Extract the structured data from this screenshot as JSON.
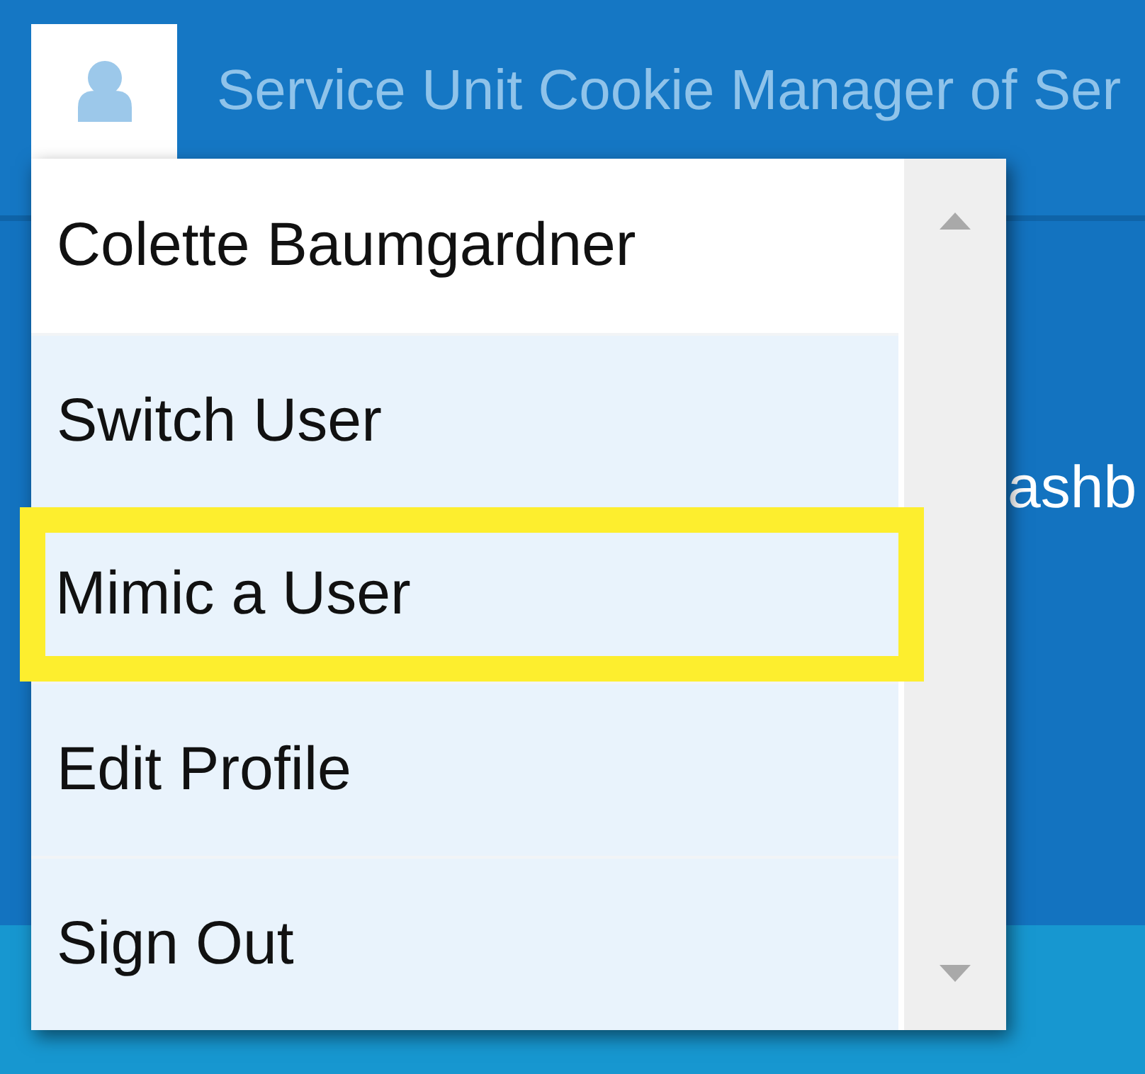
{
  "header": {
    "title": "Service Unit Cookie Manager of Ser"
  },
  "page": {
    "heading": "ashb"
  },
  "user_menu": {
    "items": [
      {
        "kind": "header",
        "label": "Colette Baumgardner",
        "highlighted": false
      },
      {
        "kind": "action",
        "label": "Switch User",
        "highlighted": false
      },
      {
        "kind": "action",
        "label": "Mimic a User",
        "highlighted": true
      },
      {
        "kind": "action",
        "label": "Edit Profile",
        "highlighted": false
      },
      {
        "kind": "action",
        "label": "Sign Out",
        "highlighted": false
      }
    ]
  }
}
